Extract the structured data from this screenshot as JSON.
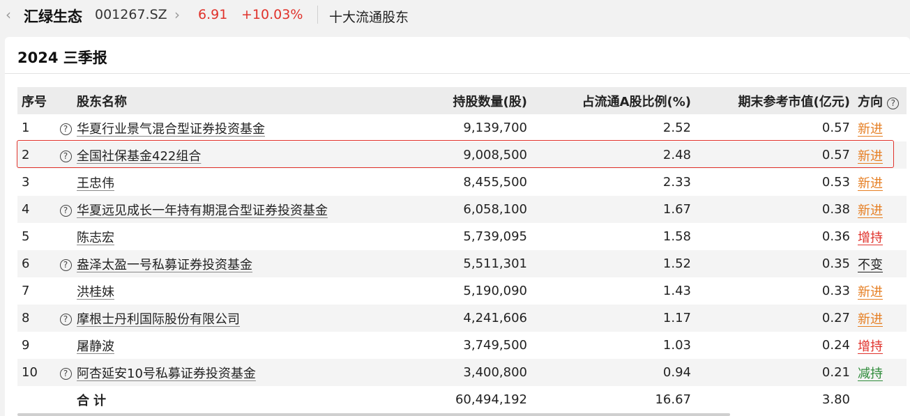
{
  "header": {
    "stock_name": "汇绿生态",
    "stock_code": "001267.SZ",
    "price": "6.91",
    "change": "+10.03%",
    "section": "十大流通股东"
  },
  "report_title": "2024 三季报",
  "columns": [
    "序号",
    "股东名称",
    "持股数量(股)",
    "占流通A股比例(%)",
    "期末参考市值(亿元)",
    "方向"
  ],
  "colors": {
    "up": "#e0322b",
    "new": "#e67e22",
    "down": "#2e8b3a",
    "flat": "#222222",
    "highlight": "#e0322b"
  },
  "rows": [
    {
      "idx": "1",
      "q": true,
      "name": "华夏行业景气混合型证券投资基金",
      "shares": "9,139,700",
      "ratio": "2.52",
      "value": "0.57",
      "dir": "新进",
      "dir_type": "new"
    },
    {
      "idx": "2",
      "q": true,
      "name": "全国社保基金422组合",
      "shares": "9,008,500",
      "ratio": "2.48",
      "value": "0.57",
      "dir": "新进",
      "dir_type": "new"
    },
    {
      "idx": "3",
      "q": false,
      "name": "王忠伟",
      "shares": "8,455,500",
      "ratio": "2.33",
      "value": "0.53",
      "dir": "新进",
      "dir_type": "new"
    },
    {
      "idx": "4",
      "q": true,
      "name": "华夏远见成长一年持有期混合型证券投资基金",
      "shares": "6,058,100",
      "ratio": "1.67",
      "value": "0.38",
      "dir": "新进",
      "dir_type": "new"
    },
    {
      "idx": "5",
      "q": false,
      "name": "陈志宏",
      "shares": "5,739,095",
      "ratio": "1.58",
      "value": "0.36",
      "dir": "增持",
      "dir_type": "up"
    },
    {
      "idx": "6",
      "q": true,
      "name": "盎泽太盈一号私募证券投资基金",
      "shares": "5,511,301",
      "ratio": "1.52",
      "value": "0.35",
      "dir": "不变",
      "dir_type": "flat"
    },
    {
      "idx": "7",
      "q": false,
      "name": "洪桂妹",
      "shares": "5,190,090",
      "ratio": "1.43",
      "value": "0.33",
      "dir": "新进",
      "dir_type": "new"
    },
    {
      "idx": "8",
      "q": true,
      "name": "摩根士丹利国际股份有限公司",
      "shares": "4,241,606",
      "ratio": "1.17",
      "value": "0.27",
      "dir": "新进",
      "dir_type": "new"
    },
    {
      "idx": "9",
      "q": false,
      "name": "屠静波",
      "shares": "3,749,500",
      "ratio": "1.03",
      "value": "0.24",
      "dir": "增持",
      "dir_type": "up"
    },
    {
      "idx": "10",
      "q": true,
      "name": "阿杏延安10号私募证券投资基金",
      "shares": "3,400,800",
      "ratio": "0.94",
      "value": "0.21",
      "dir": "减持",
      "dir_type": "down"
    }
  ],
  "total": {
    "label": "合计",
    "shares": "60,494,192",
    "ratio": "16.67",
    "value": "3.80"
  }
}
